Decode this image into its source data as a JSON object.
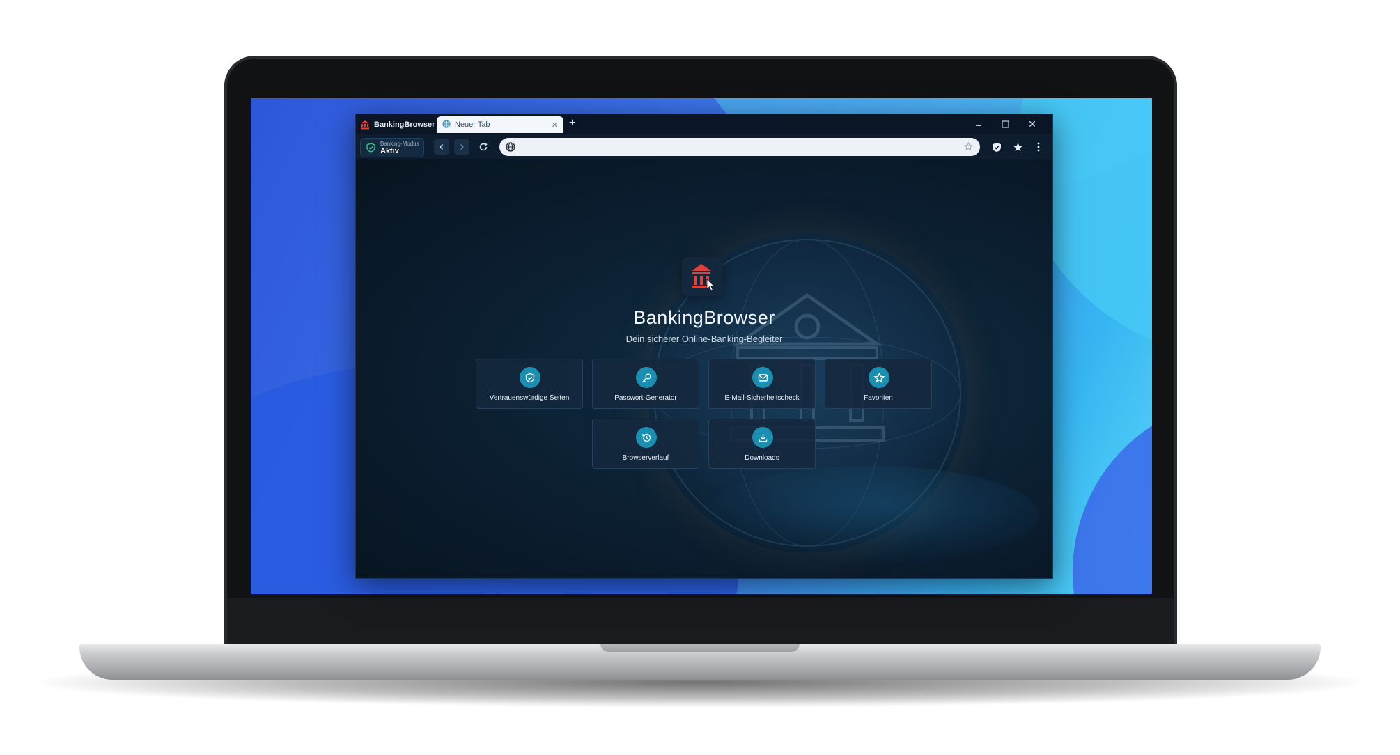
{
  "app": {
    "name": "BankingBrowser"
  },
  "tabs": [
    {
      "label": "Neuer Tab"
    }
  ],
  "toolbar": {
    "mode_label": "Banking-Modus",
    "mode_status": "Aktiv",
    "url_value": ""
  },
  "home": {
    "title": "BankingBrowser",
    "subtitle": "Dein sicherer Online-Banking-Begleiter",
    "shortcuts": [
      {
        "label": "Vertrauenswürdige Seiten",
        "icon": "shield-check-icon"
      },
      {
        "label": "Passwort-Generator",
        "icon": "key-icon"
      },
      {
        "label": "E-Mail-Sicherheitscheck",
        "icon": "mail-icon"
      },
      {
        "label": "Favoriten",
        "icon": "star-icon"
      },
      {
        "label": "Browserverlauf",
        "icon": "history-icon"
      },
      {
        "label": "Downloads",
        "icon": "download-icon"
      }
    ]
  },
  "colors": {
    "accent": "#1a8fb1",
    "brand_red": "#e0413a",
    "window_bg": "#0b1a2b"
  }
}
